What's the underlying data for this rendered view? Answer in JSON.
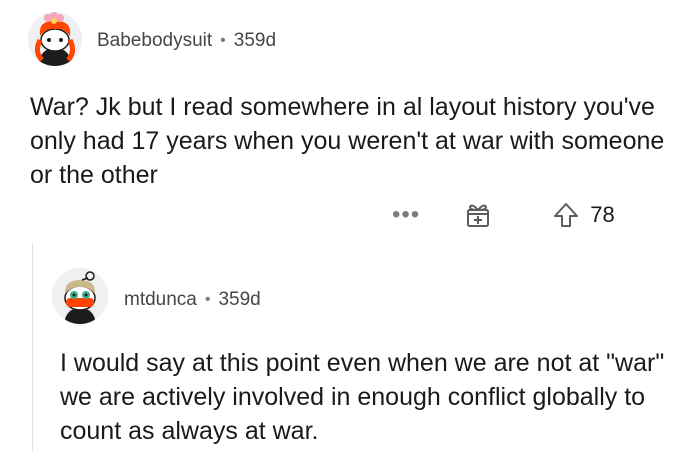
{
  "comments": [
    {
      "username": "Babebodysuit",
      "separator": "•",
      "age": "359d",
      "body": "War? Jk but I read somewhere in al layout history you've only had 17 years when you weren't at war with someone or the other",
      "actions": {
        "more_icon": "ellipsis-icon",
        "award_icon": "gift-award-icon",
        "upvote_icon": "upvote-arrow-icon",
        "score": "78"
      },
      "avatar_colors": {
        "hair": "#ffffff",
        "shirt": "#000000",
        "accent": "#ff4500"
      }
    },
    {
      "username": "mtdunca",
      "separator": "•",
      "age": "359d",
      "body": "I would say at this point even when we are not at \"war\" we are actively involved in enough conflict globally to count as always at war.",
      "avatar_colors": {
        "hair": "#c9b98a",
        "mask": "#ff4500",
        "shirt": "#1c1c1c"
      }
    }
  ]
}
